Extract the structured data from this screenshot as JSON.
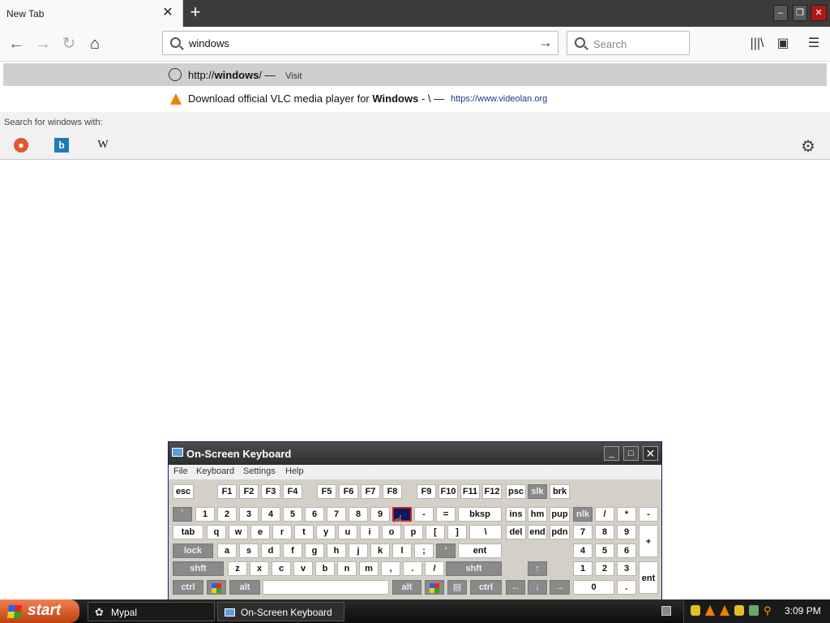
{
  "browser": {
    "tab_title": "New Tab",
    "tab_close": "✕",
    "new_tab": "+",
    "url_value": "windows",
    "search_placeholder": "Search"
  },
  "dropdown": {
    "suggestion1_prefix": "http://",
    "suggestion1_bold": "windows",
    "suggestion1_suffix": "/ —",
    "suggestion1_action": "Visit",
    "suggestion2_text": "Download official VLC media player for",
    "suggestion2_bold": "Windows",
    "suggestion2_sep": "- \\  —",
    "suggestion2_url": "https://www.videolan.org",
    "search_with_label": "Search for",
    "search_with_term": "windows",
    "search_with_suffix": "with:",
    "wiki_label": "W",
    "bing_label": "b"
  },
  "osk": {
    "title": "On-Screen Keyboard",
    "menu": [
      "File",
      "Keyboard",
      "Settings",
      "Help"
    ],
    "fkeys": [
      "esc",
      "F1",
      "F2",
      "F3",
      "F4",
      "F5",
      "F6",
      "F7",
      "F8",
      "F9",
      "F10",
      "F11",
      "F12",
      "psc",
      "slk",
      "brk"
    ],
    "row1": [
      "`",
      "1",
      "2",
      "3",
      "4",
      "5",
      "6",
      "7",
      "8",
      "9",
      "0",
      "-",
      "=",
      "bksp",
      "ins",
      "hm",
      "pup",
      "nlk",
      "/",
      "*",
      "-"
    ],
    "row2": [
      "tab",
      "q",
      "w",
      "e",
      "r",
      "t",
      "y",
      "u",
      "i",
      "o",
      "p",
      "[",
      "]",
      "\\",
      "del",
      "end",
      "pdn",
      "7",
      "8",
      "9",
      "+"
    ],
    "row3": [
      "lock",
      "a",
      "s",
      "d",
      "f",
      "g",
      "h",
      "j",
      "k",
      "l",
      ";",
      "'",
      "ent",
      "4",
      "5",
      "6"
    ],
    "row4": [
      "shft",
      "z",
      "x",
      "c",
      "v",
      "b",
      "n",
      "m",
      ",",
      ".",
      "/",
      "shft",
      "↑",
      "1",
      "2",
      "3",
      "ent"
    ],
    "row5": [
      "ctrl",
      "",
      "alt",
      "",
      "alt",
      "",
      "",
      "ctrl",
      "←",
      "↓",
      "→",
      "0",
      "."
    ]
  },
  "taskbar": {
    "start": "start",
    "task1": "Mypal",
    "task2": "On-Screen Keyboard",
    "clock": "3:09 PM"
  }
}
